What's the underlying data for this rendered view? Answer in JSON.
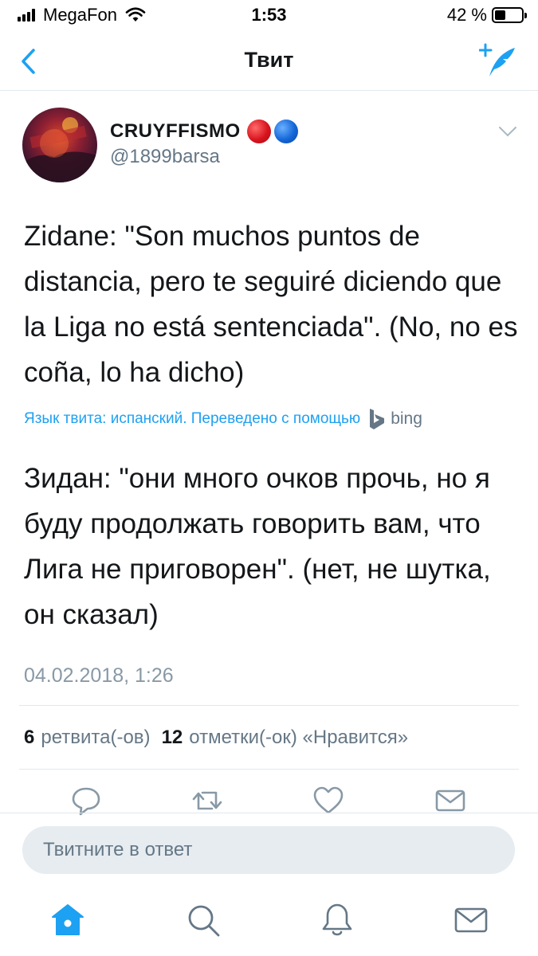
{
  "status_bar": {
    "carrier": "MegaFon",
    "time": "1:53",
    "battery": "42 %",
    "battery_level": 0.42
  },
  "nav": {
    "title": "Твит",
    "back_icon": "chevron-left-icon",
    "compose_icon": "compose-tweet-icon"
  },
  "tweet": {
    "display_name": "CRUYFFISMO",
    "handle": "@1899barsa",
    "text": "Zidane: \"Son muchos puntos de distancia, pero te seguiré diciendo que la Liga no está sentenciada\". (No, no es coña, lo ha dicho)",
    "translation_note": "Язык твита: испанский. Переведено с помощью",
    "translator": "bing",
    "translated_text": "Зидан: \"они много очков прочь, но я буду продолжать говорить вам, что Лига не приговорен\". (нет, не шутка, он сказал)",
    "timestamp": "04.02.2018, 1:26"
  },
  "stats": {
    "retweets_count": "6",
    "retweets_label": "ретвита(-ов)",
    "likes_count": "12",
    "likes_label": "отметки(-ок) «Нравится»"
  },
  "actions": [
    "reply-icon",
    "retweet-icon",
    "like-icon",
    "direct-message-icon"
  ],
  "reply": {
    "placeholder": "Твитните в ответ"
  },
  "tab_bar": [
    "home-icon",
    "search-icon",
    "notifications-icon",
    "messages-icon"
  ],
  "colors": {
    "accent": "#1da1f2",
    "muted": "#657786",
    "text": "#14171a",
    "input_bg": "#e6ecf0"
  }
}
